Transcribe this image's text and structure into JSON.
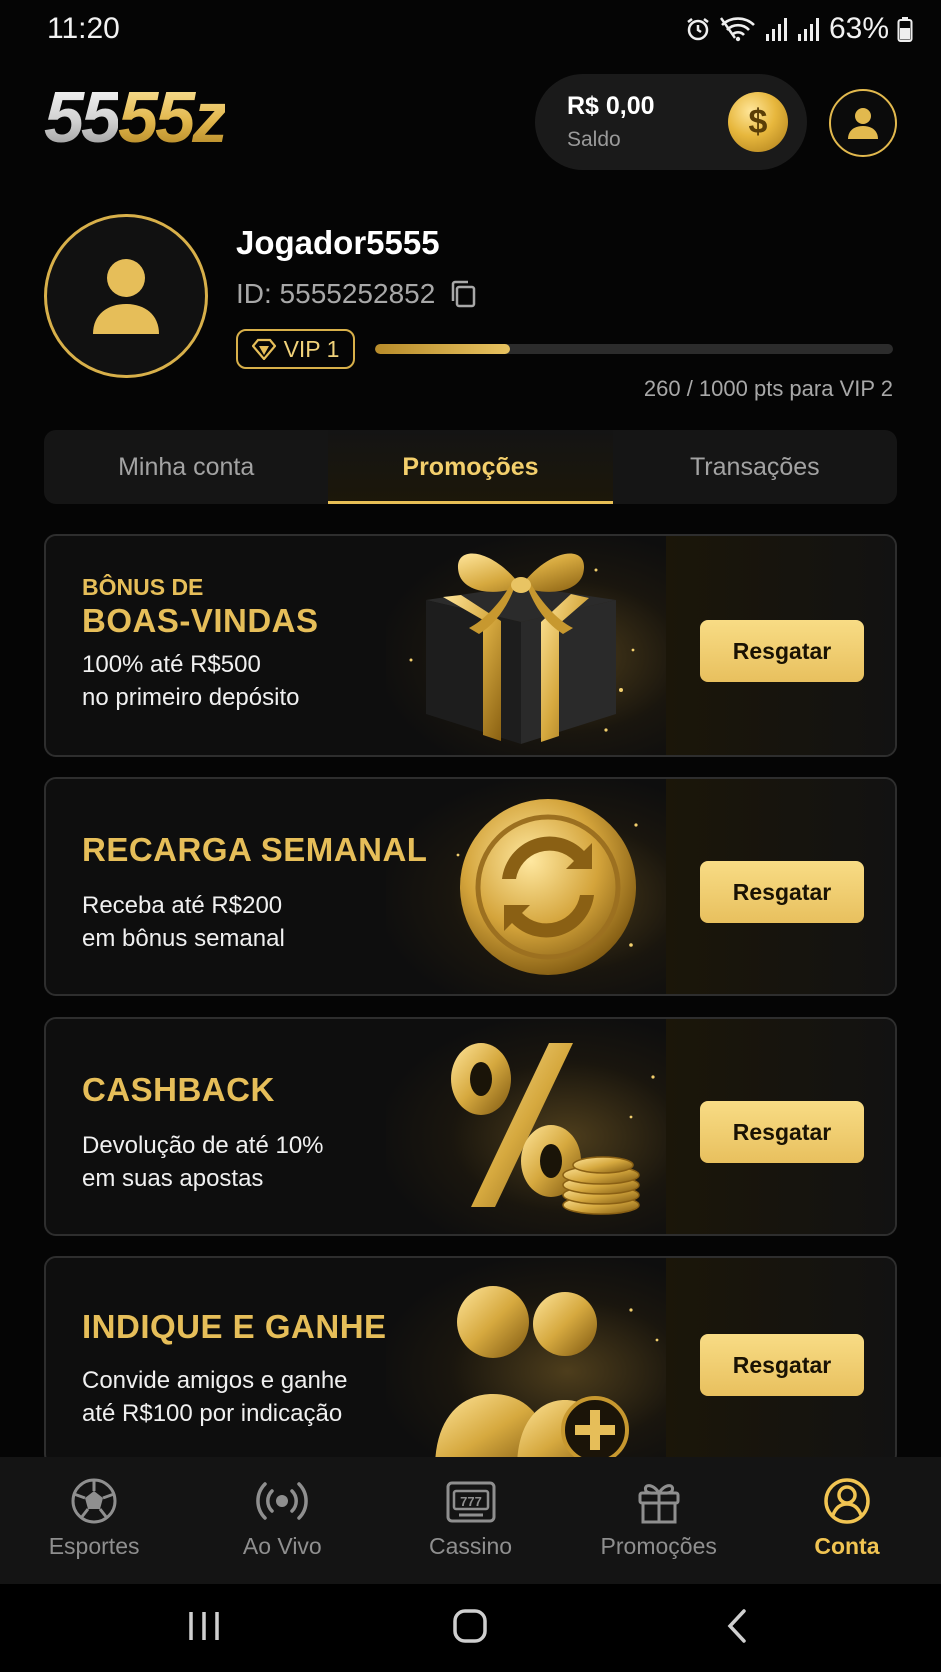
{
  "status_bar": {
    "time": "11:20",
    "battery": "63%"
  },
  "header": {
    "logo_white": "55",
    "logo_gold": "55z",
    "balance_amount": "R$ 0,00",
    "balance_label": "Saldo",
    "coin_symbol": "$"
  },
  "profile": {
    "username": "Jogador5555",
    "id_text": "ID: 5555252852",
    "vip_level": "VIP 1",
    "vip_progress": 0.26,
    "vip_progress_text": "260 / 1000 pts para VIP 2"
  },
  "tabs": [
    {
      "label": "Minha conta",
      "active": false
    },
    {
      "label": "Promoções",
      "active": true
    },
    {
      "label": "Transações",
      "active": false
    }
  ],
  "promotions": [
    {
      "eyebrow": "BÔNUS DE",
      "title": "BOAS-VINDAS",
      "desc_line1": "100% até R$500",
      "desc_line2": "no primeiro depósito",
      "button": "Resgatar",
      "art": "gift-box-icon"
    },
    {
      "eyebrow": "",
      "title": "RECARGA SEMANAL",
      "desc_line1": "Receba até R$200",
      "desc_line2": "em bônus semanal",
      "button": "Resgatar",
      "art": "refresh-coin-icon"
    },
    {
      "eyebrow": "",
      "title": "CASHBACK",
      "desc_line1": "Devolução de até 10%",
      "desc_line2": "em suas apostas",
      "button": "Resgatar",
      "art": "percent-coins-icon"
    },
    {
      "eyebrow": "",
      "title": "INDIQUE E GANHE",
      "desc_line1": "Convide amigos e ganhe",
      "desc_line2": "até R$100 por indicação",
      "button": "Resgatar",
      "art": "refer-friends-icon"
    }
  ],
  "bottom_nav": [
    {
      "label": "Esportes",
      "icon": "soccer-ball-icon",
      "active": false
    },
    {
      "label": "Ao Vivo",
      "icon": "live-broadcast-icon",
      "active": false
    },
    {
      "label": "Cassino",
      "icon": "slot-machine-icon",
      "active": false
    },
    {
      "label": "Promoções",
      "icon": "gift-icon",
      "active": false
    },
    {
      "label": "Conta",
      "icon": "account-icon",
      "active": true
    }
  ],
  "colors": {
    "gold": "#e6be59",
    "background": "#050505",
    "button": "#f3cf6c"
  }
}
